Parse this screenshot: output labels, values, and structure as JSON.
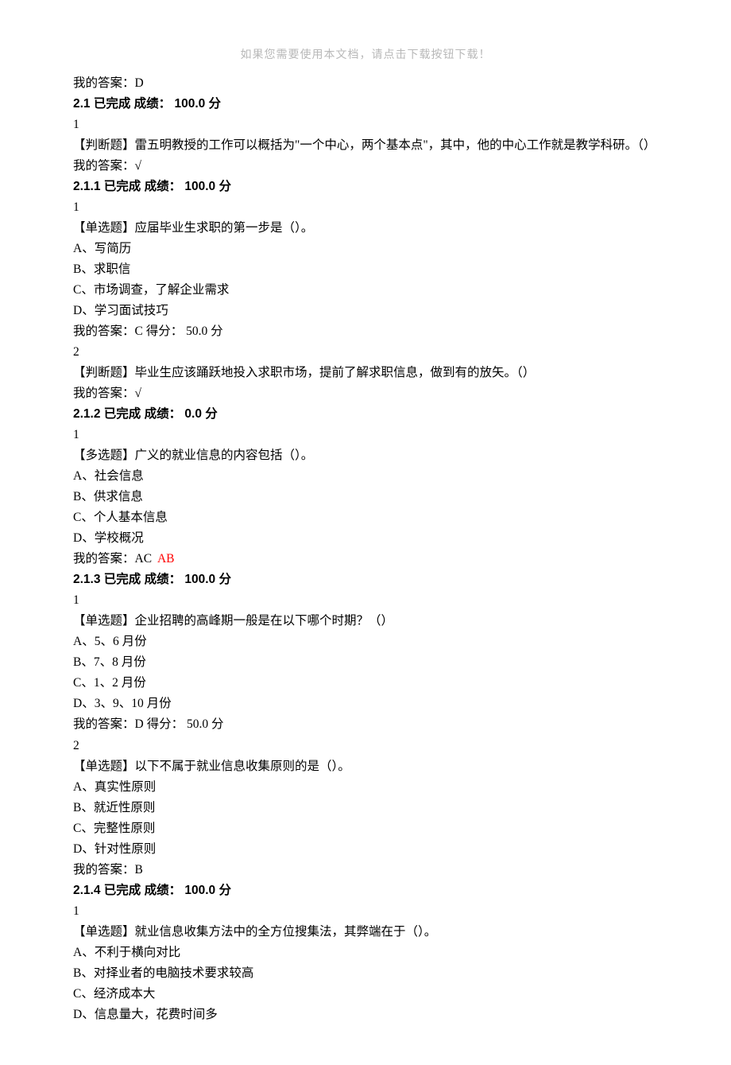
{
  "header": "如果您需要使用本文档，请点击下载按钮下载！",
  "lines": [
    {
      "text": "我的答案：D"
    },
    {
      "bold": true,
      "text": "2.1 已完成 成绩： 100.0 分"
    },
    {
      "text": "1"
    },
    {
      "text": "【判断题】雷五明教授的工作可以概括为\"一个中心，两个基本点\"，其中，他的中心工作就是教学科研。（）"
    },
    {
      "text": "我的答案：√"
    },
    {
      "bold": true,
      "text": "2.1.1 已完成 成绩： 100.0 分"
    },
    {
      "text": "1"
    },
    {
      "text": "【单选题】应届毕业生求职的第一步是（）。"
    },
    {
      "text": "A、写简历"
    },
    {
      "text": "B、求职信"
    },
    {
      "text": "C、市场调查，了解企业需求"
    },
    {
      "text": "D、学习面试技巧"
    },
    {
      "text": "我的答案：C 得分： 50.0 分"
    },
    {
      "text": "2"
    },
    {
      "text": "【判断题】毕业生应该踊跃地投入求职市场，提前了解求职信息，做到有的放矢。（）"
    },
    {
      "text": "我的答案：√"
    },
    {
      "bold": true,
      "text": "2.1.2 已完成 成绩： 0.0 分"
    },
    {
      "text": "1"
    },
    {
      "text": "【多选题】广义的就业信息的内容包括（）。"
    },
    {
      "text": "A、社会信息"
    },
    {
      "text": "B、供求信息"
    },
    {
      "text": "C、个人基本信息"
    },
    {
      "text": "D、学校概况"
    },
    {
      "prefix": "我的答案：AC  ",
      "red": "AB"
    },
    {
      "bold": true,
      "text": "2.1.3 已完成 成绩： 100.0 分"
    },
    {
      "text": "1"
    },
    {
      "text": "【单选题】企业招聘的高峰期一般是在以下哪个时期？（）"
    },
    {
      "text": "A、5、6 月份"
    },
    {
      "text": "B、7、8 月份"
    },
    {
      "text": "C、1、2 月份"
    },
    {
      "text": "D、3、9、10 月份"
    },
    {
      "text": "我的答案：D 得分： 50.0 分"
    },
    {
      "text": "2"
    },
    {
      "text": "【单选题】以下不属于就业信息收集原则的是（）。"
    },
    {
      "text": "A、真实性原则"
    },
    {
      "text": "B、就近性原则"
    },
    {
      "text": "C、完整性原则"
    },
    {
      "text": "D、针对性原则"
    },
    {
      "text": "我的答案：B"
    },
    {
      "bold": true,
      "text": "2.1.4 已完成 成绩： 100.0 分"
    },
    {
      "text": "1"
    },
    {
      "text": "【单选题】就业信息收集方法中的全方位搜集法，其弊端在于（）。"
    },
    {
      "text": "A、不利于横向对比"
    },
    {
      "text": "B、对择业者的电脑技术要求较高"
    },
    {
      "text": "C、经济成本大"
    },
    {
      "text": "D、信息量大，花费时间多"
    }
  ]
}
